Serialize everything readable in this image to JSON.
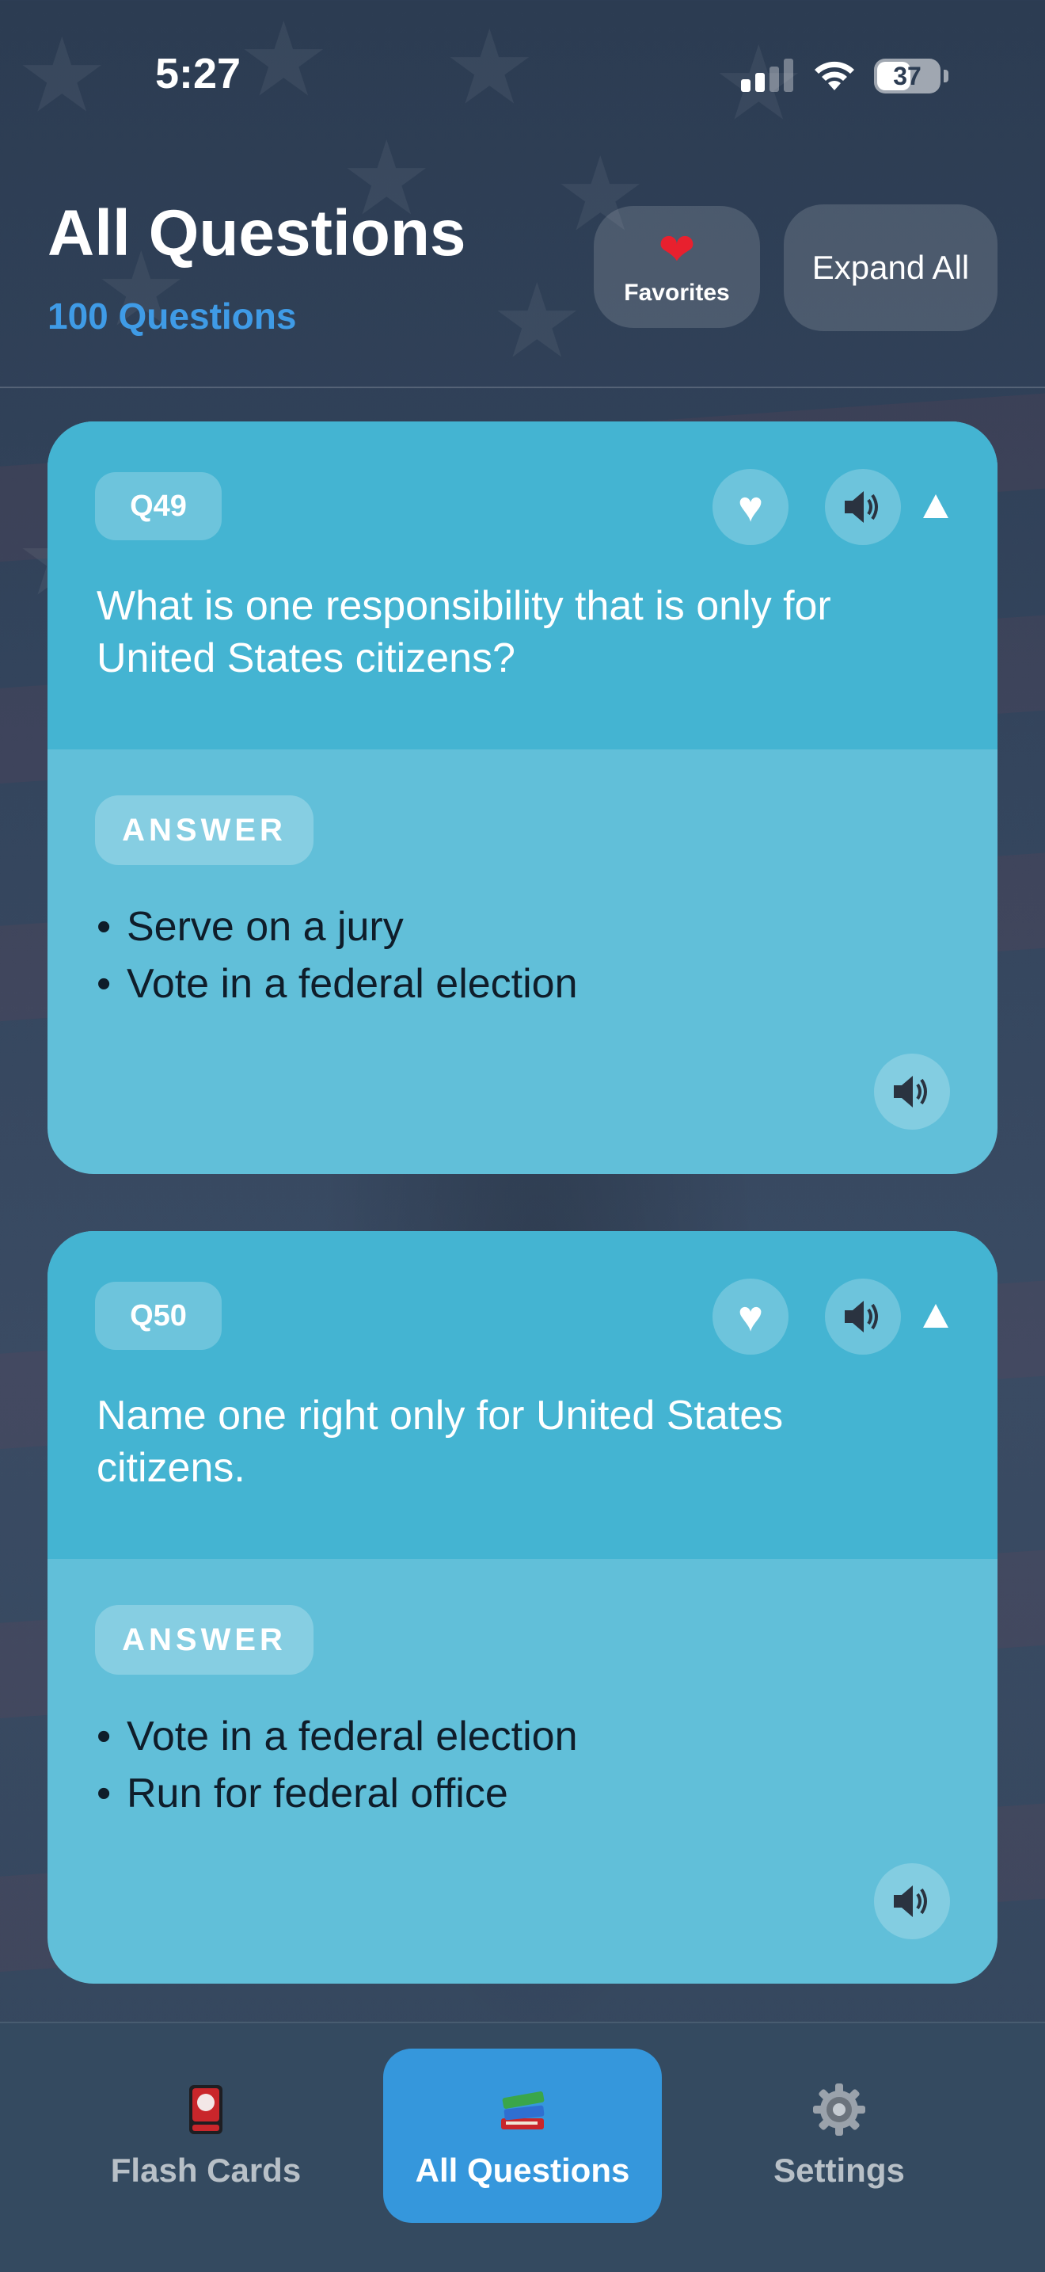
{
  "status_bar": {
    "time": "5:27",
    "battery": "37"
  },
  "header": {
    "title": "All Questions",
    "subtitle": "100 Questions",
    "favorites_label": "Favorites",
    "favorites_icon": "red-heart-icon",
    "expand_label": "Expand All"
  },
  "cards": [
    {
      "number": "Q49",
      "question": "What is one responsibility that is only for United States citizens?",
      "answer_label": "ANSWER",
      "answers": [
        "Serve on a jury",
        "Vote in a federal election"
      ],
      "favorite": false,
      "expanded": true
    },
    {
      "number": "Q50",
      "question": "Name one right only for United States citizens.",
      "answer_label": "ANSWER",
      "answers": [
        "Vote in a federal election",
        "Run for federal office"
      ],
      "favorite": false,
      "expanded": true
    }
  ],
  "tabs": [
    {
      "label": "Flash Cards",
      "icon": "flash-card-icon",
      "active": false
    },
    {
      "label": "All Questions",
      "icon": "books-icon",
      "active": true
    },
    {
      "label": "Settings",
      "icon": "gear-icon",
      "active": false
    }
  ],
  "colors": {
    "accent_blue": "#3f9be6",
    "card_top": "#44b4d2",
    "card_bottom": "#61bfd9",
    "tab_active": "#3597dc",
    "heart_red": "#e8202e"
  }
}
